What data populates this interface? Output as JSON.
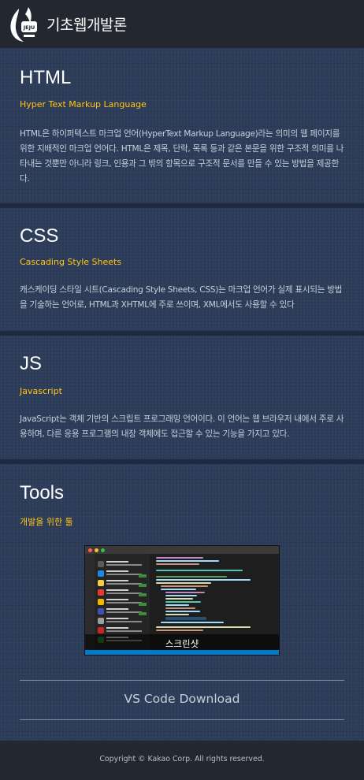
{
  "header": {
    "site_title": "기초웹개발론",
    "logo_text": "JEJU"
  },
  "sections": [
    {
      "title": "HTML",
      "subtitle": "Hyper Text Markup Language",
      "description": "HTML은 하이퍼텍스트 마크업 언어(HyperText Markup Language)라는 의미의 웹 페이지를 위한 지배적인 마크업 언어다. HTML은 제목, 단락, 목록 등과 같은 본문을 위한 구조적 의미를 나타내는 것뿐만 아니라 링크, 인용과 그 밖의 항목으로 구조적 문서를 만들 수 있는 방법을 제공한다."
    },
    {
      "title": "CSS",
      "subtitle": "Cascading Style Sheets",
      "description": "캐스케이딩 스타일 시트(Cascading Style Sheets, CSS)는 마크업 언어가 실제 표시되는 방법을 기술하는 언어로, HTML과 XHTML에 주로 쓰이며, XML에서도 사용할 수 있다"
    },
    {
      "title": "JS",
      "subtitle": "Javascript",
      "description": "JavaScript는 객체 기반의 스크립트 프로그래밍 언어이다. 이 언어는 웹 브라우저 내에서 주로 사용하며, 다른 응용 프로그램의 내장 객체에도 접근할 수 있는 기능을 가지고 있다."
    },
    {
      "title": "Tools",
      "subtitle": "개발을 위한 툴"
    }
  ],
  "screenshot": {
    "caption": "스크린샷"
  },
  "download": {
    "label": "VS Code Download"
  },
  "footer": {
    "copyright": "Copyright © Kakao Corp. All rights reserved."
  },
  "colors": {
    "accent": "#ffc61a",
    "header_bg": "#23272f",
    "section_bg": "#2d3c58"
  }
}
